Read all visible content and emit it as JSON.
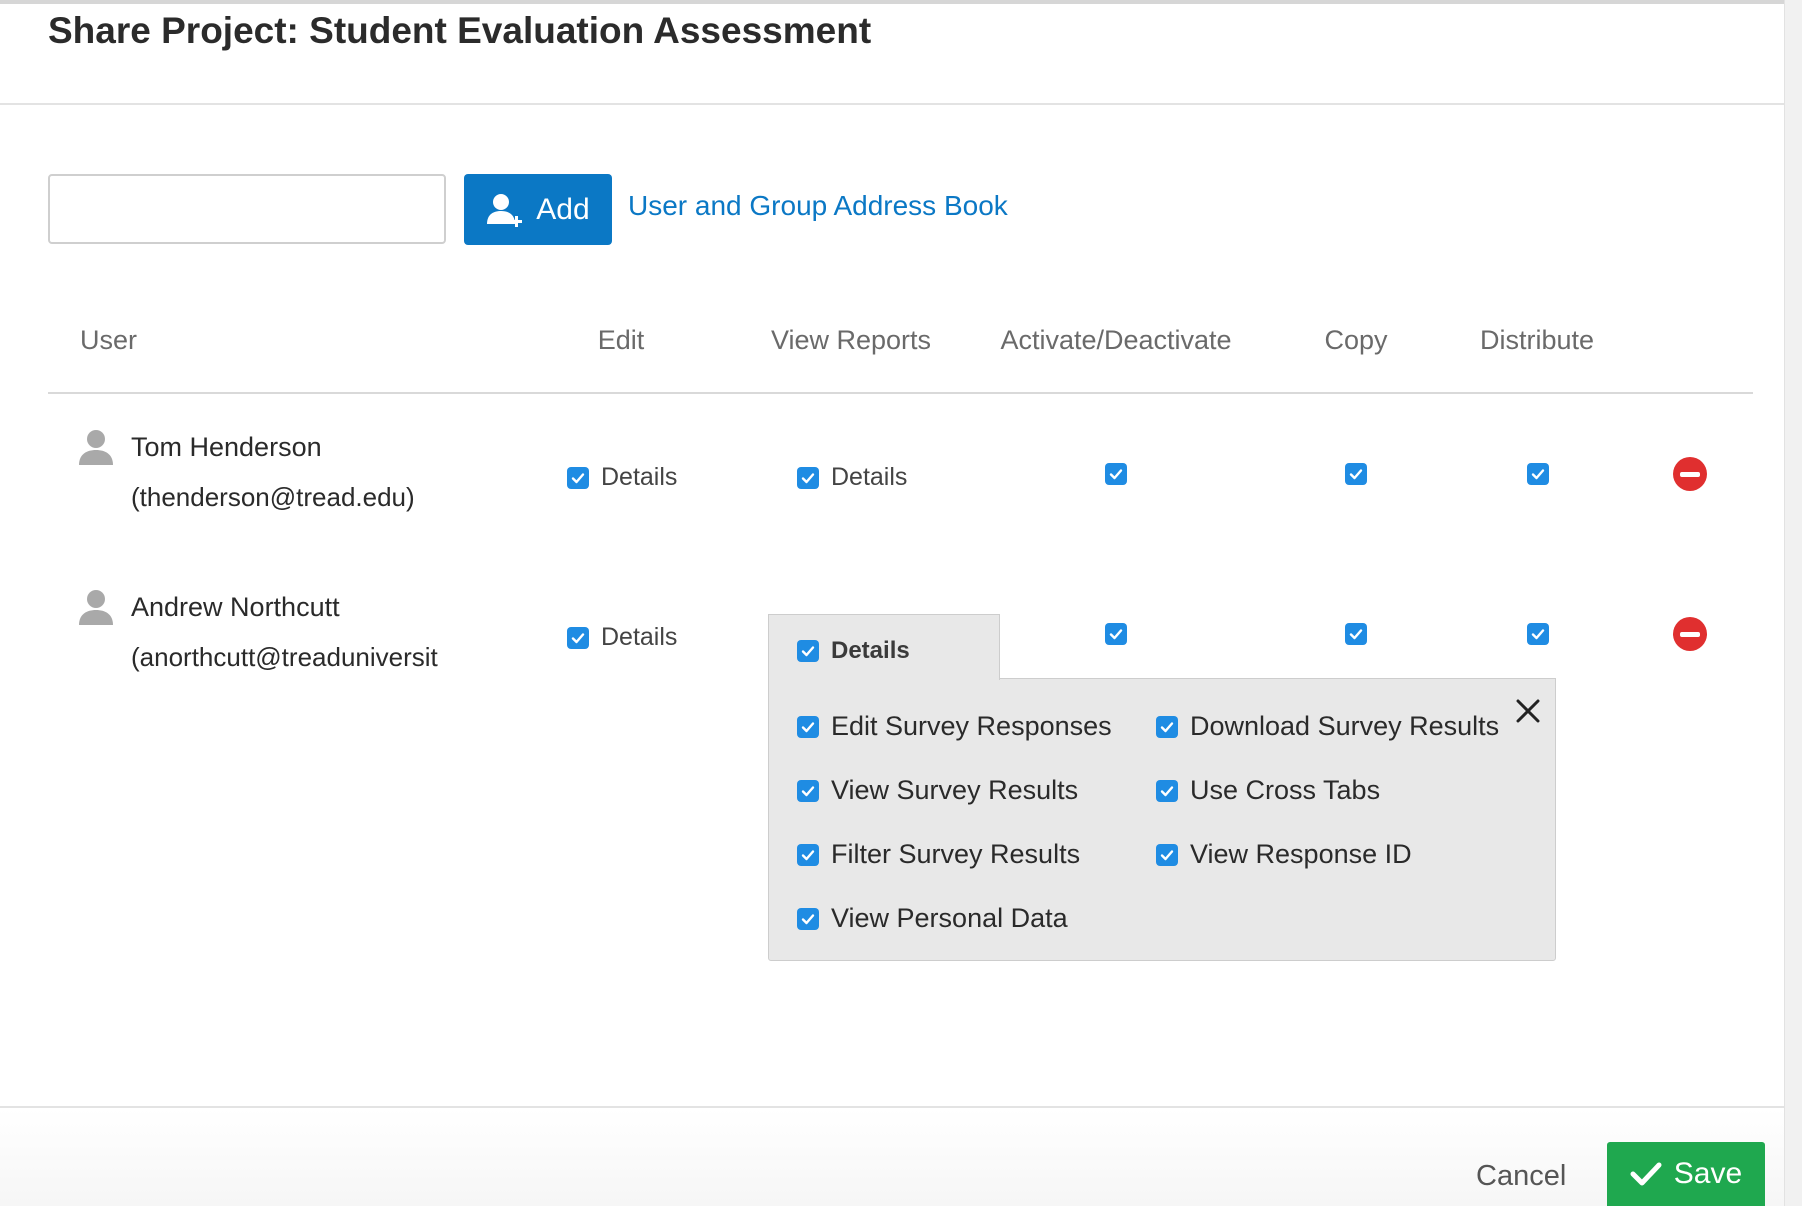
{
  "dialog": {
    "title": "Share Project: Student Evaluation Assessment"
  },
  "search": {
    "value": "",
    "placeholder": ""
  },
  "add_button": {
    "label": "Add",
    "icon": "add-user-icon"
  },
  "address_book_link": "User and Group Address Book",
  "columns": [
    "User",
    "Edit",
    "View Reports",
    "Activate/Deactivate",
    "Copy",
    "Distribute"
  ],
  "users": [
    {
      "name": "Tom Henderson",
      "email": "(thenderson@tread.edu)",
      "edit": {
        "checked": true,
        "label": "Details"
      },
      "view_reports": {
        "checked": true,
        "label": "Details"
      },
      "activate": true,
      "copy": true,
      "distribute": true
    },
    {
      "name": "Andrew Northcutt",
      "email": "(anorthcutt@treaduniversit",
      "edit": {
        "checked": true,
        "label": "Details"
      },
      "view_reports": {
        "checked": true,
        "label": "Details"
      },
      "activate": true,
      "copy": true,
      "distribute": true
    }
  ],
  "details_popover": {
    "title": "Details",
    "options": [
      {
        "label": "Edit Survey Responses",
        "checked": true
      },
      {
        "label": "Download Survey Results",
        "checked": true
      },
      {
        "label": "View Survey Results",
        "checked": true
      },
      {
        "label": "Use Cross Tabs",
        "checked": true
      },
      {
        "label": "Filter Survey Results",
        "checked": true
      },
      {
        "label": "View Response ID",
        "checked": true
      },
      {
        "label": "View Personal Data",
        "checked": true
      }
    ]
  },
  "footer": {
    "cancel_label": "Cancel",
    "save_label": "Save"
  },
  "colors": {
    "primary": "#0b78c5",
    "checkbox": "#1f8ce3",
    "remove": "#e02f2f",
    "save": "#1fa84f",
    "popover_bg": "#e8e8e8"
  }
}
